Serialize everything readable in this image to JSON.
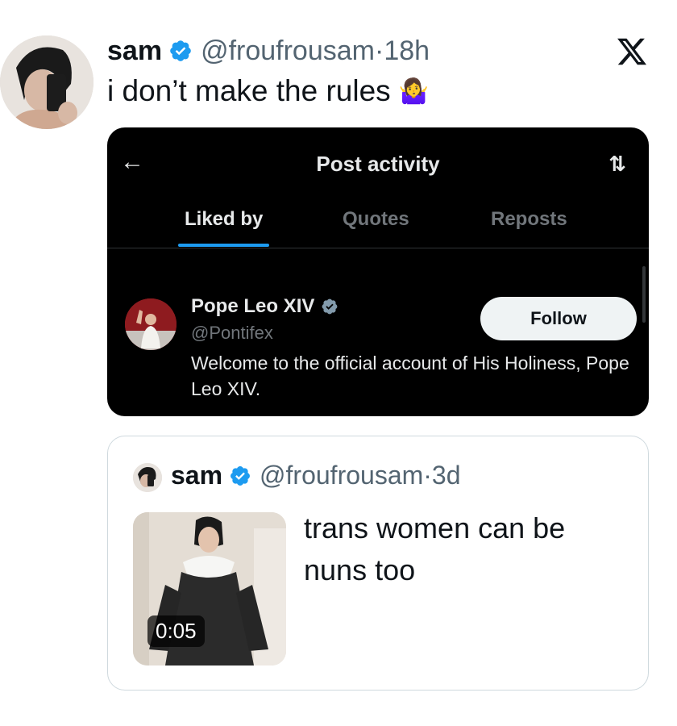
{
  "tweet": {
    "author_name": "sam",
    "handle": "@froufrousam",
    "separator": "·",
    "time": "18h",
    "text": "i don’t make the rules",
    "emoji": "🤷‍♀️",
    "avatar_icon": "selfie-avatar",
    "platform_logo": "x-logo"
  },
  "screenshot": {
    "back_icon": "←",
    "title": "Post activity",
    "sort_icon": "⇅",
    "tabs": [
      {
        "label": "Liked by",
        "active": true
      },
      {
        "label": "Quotes",
        "active": false
      },
      {
        "label": "Reposts",
        "active": false
      }
    ],
    "user": {
      "name": "Pope Leo XIV",
      "handle": "@Pontifex",
      "bio": "Welcome to the official account of His Holiness, Pope Leo XIV.",
      "follow_label": "Follow"
    }
  },
  "quoted": {
    "author_name": "sam",
    "handle": "@froufrousam",
    "separator": "·",
    "time": "3d",
    "text": "trans women can be nuns too",
    "duration": "0:05"
  },
  "colors": {
    "verified_blue": "#1d9bf0",
    "dark_bg": "#000000",
    "secondary_text": "#536471"
  }
}
